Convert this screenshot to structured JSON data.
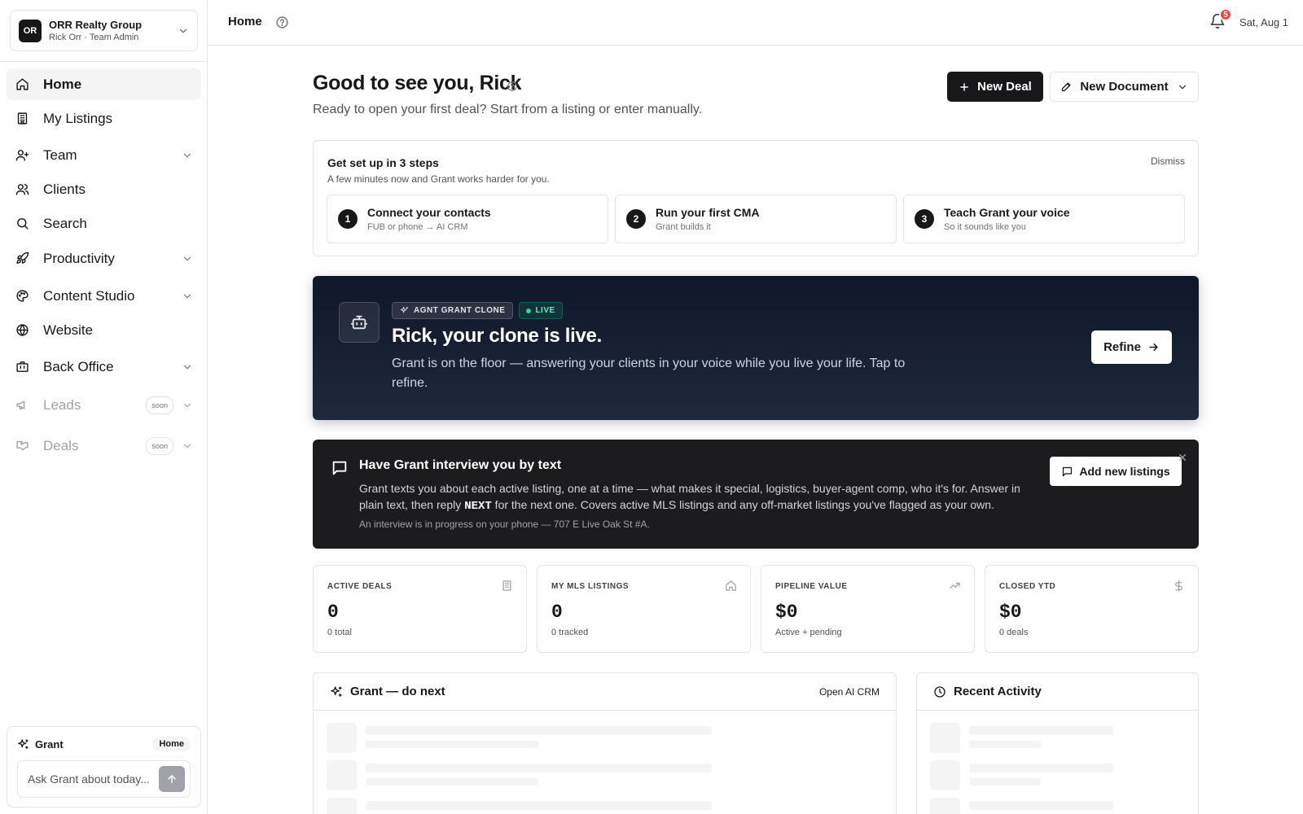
{
  "org": {
    "initials": "OR",
    "name": "ORR Realty Group",
    "user_role": "Rick Orr · Team Admin"
  },
  "nav": [
    {
      "label": "Home",
      "icon": "home-icon",
      "active": true
    },
    {
      "label": "My Listings",
      "icon": "building-icon"
    },
    {
      "label": "Team",
      "icon": "user-plus-icon",
      "expandable": true
    },
    {
      "label": "Clients",
      "icon": "users-icon"
    },
    {
      "label": "Search",
      "icon": "search-icon"
    },
    {
      "label": "Productivity",
      "icon": "rocket-icon",
      "expandable": true
    },
    {
      "label": "Content Studio",
      "icon": "palette-icon",
      "expandable": true
    },
    {
      "label": "Website",
      "icon": "globe-icon"
    },
    {
      "label": "Back Office",
      "icon": "briefcase-icon",
      "expandable": true
    },
    {
      "label": "Leads",
      "icon": "megaphone-icon",
      "badge": "soon",
      "disabled": true,
      "expandable": true
    },
    {
      "label": "Deals",
      "icon": "handshake-icon",
      "badge": "soon",
      "disabled": true,
      "expandable": true
    }
  ],
  "grant_box": {
    "title": "Grant",
    "context_pill": "Home",
    "input_placeholder": "Ask Grant about today..."
  },
  "topbar": {
    "title": "Home",
    "notification_count": "5",
    "date": "Sat, Aug 1"
  },
  "header": {
    "greeting": "Good to see you, Rick",
    "subtitle": "Ready to open your first deal? Start from a listing or enter manually.",
    "new_deal_label": "New Deal",
    "new_document_label": "New Document"
  },
  "setup": {
    "title": "Get set up in 3 steps",
    "subtitle": "A few minutes now and Grant works harder for you.",
    "dismiss_label": "Dismiss",
    "steps": [
      {
        "num": "1",
        "title": "Connect your contacts",
        "sub": "FUB or phone → AI CRM"
      },
      {
        "num": "2",
        "title": "Run your first CMA",
        "sub": "Grant builds it"
      },
      {
        "num": "3",
        "title": "Teach Grant your voice",
        "sub": "So it sounds like you"
      }
    ]
  },
  "clone": {
    "tag": "AGNT GRANT CLONE",
    "live_tag": "LIVE",
    "title": "Rick, your clone is live.",
    "text": "Grant is on the floor — answering your clients in your voice while you live your life. Tap to refine.",
    "refine_label": "Refine"
  },
  "interview": {
    "title": "Have Grant interview you by text",
    "text_before": "Grant texts you about each active listing, one at a time — what makes it special, logistics, buyer-agent comp, who it's for. Answer in plain text, then reply ",
    "text_keyword": "NEXT",
    "text_after": " for the next one. Covers active MLS listings and any off-market listings you've flagged as your own.",
    "footnote": "An interview is in progress on your phone — 707 E Live Oak St #A.",
    "add_listings_label": "Add new listings"
  },
  "stats": [
    {
      "label": "ACTIVE DEALS",
      "value": "0",
      "sub": "0 total",
      "icon": "building-icon"
    },
    {
      "label": "MY MLS LISTINGS",
      "value": "0",
      "sub": "0 tracked",
      "icon": "house-icon"
    },
    {
      "label": "PIPELINE VALUE",
      "value": "$0",
      "sub": "Active + pending",
      "icon": "trending-up-icon"
    },
    {
      "label": "CLOSED YTD",
      "value": "$0",
      "sub": "0 deals",
      "icon": "dollar-icon"
    }
  ],
  "do_next": {
    "title": "Grant — do next",
    "link_label": "Open AI CRM"
  },
  "recent_activity": {
    "title": "Recent Activity"
  }
}
